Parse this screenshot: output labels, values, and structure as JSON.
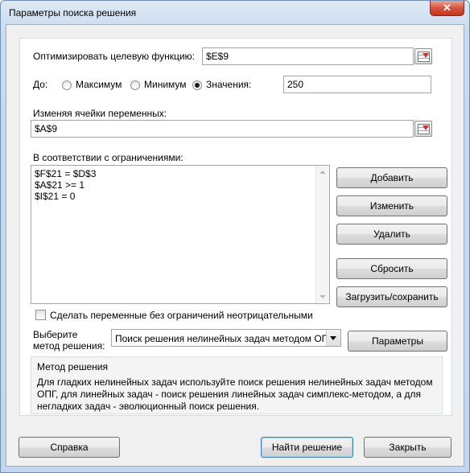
{
  "window": {
    "title": "Параметры поиска решения",
    "close_glyph": "✕"
  },
  "objective": {
    "label": "Оптимизировать целевую функцию:",
    "value": "$E$9"
  },
  "to": {
    "label": "До:",
    "options": [
      {
        "label": "Максимум",
        "checked": false
      },
      {
        "label": "Минимум",
        "checked": false
      },
      {
        "label": "Значения:",
        "checked": true
      }
    ],
    "value": "250"
  },
  "changing": {
    "label": "Изменяя ячейки переменных:",
    "value": "$A$9"
  },
  "constraints": {
    "label": "В соответствии с ограничениями:",
    "items": [
      "$F$21 = $D$3",
      "$A$21 >= 1",
      "$I$21 = 0"
    ]
  },
  "buttons": {
    "add": "Добавить",
    "change": "Изменить",
    "delete": "Удалить",
    "reset": "Сбросить",
    "load_save": "Загрузить/сохранить",
    "options": "Параметры",
    "help": "Справка",
    "solve": "Найти решение",
    "close": "Закрыть"
  },
  "nonneg": {
    "label": "Сделать переменные без ограничений неотрицательными",
    "checked": false
  },
  "method": {
    "label_line1": "Выберите",
    "label_line2": "метод решения:",
    "selected": "Поиск решения нелинейных задач методом ОПГ"
  },
  "method_group": {
    "title": "Метод решения",
    "text": "Для гладких нелинейных задач используйте поиск решения нелинейных задач методом ОПГ, для линейных задач - поиск решения линейных задач симплекс-методом, а для негладких задач - эволюционный поиск решения."
  }
}
